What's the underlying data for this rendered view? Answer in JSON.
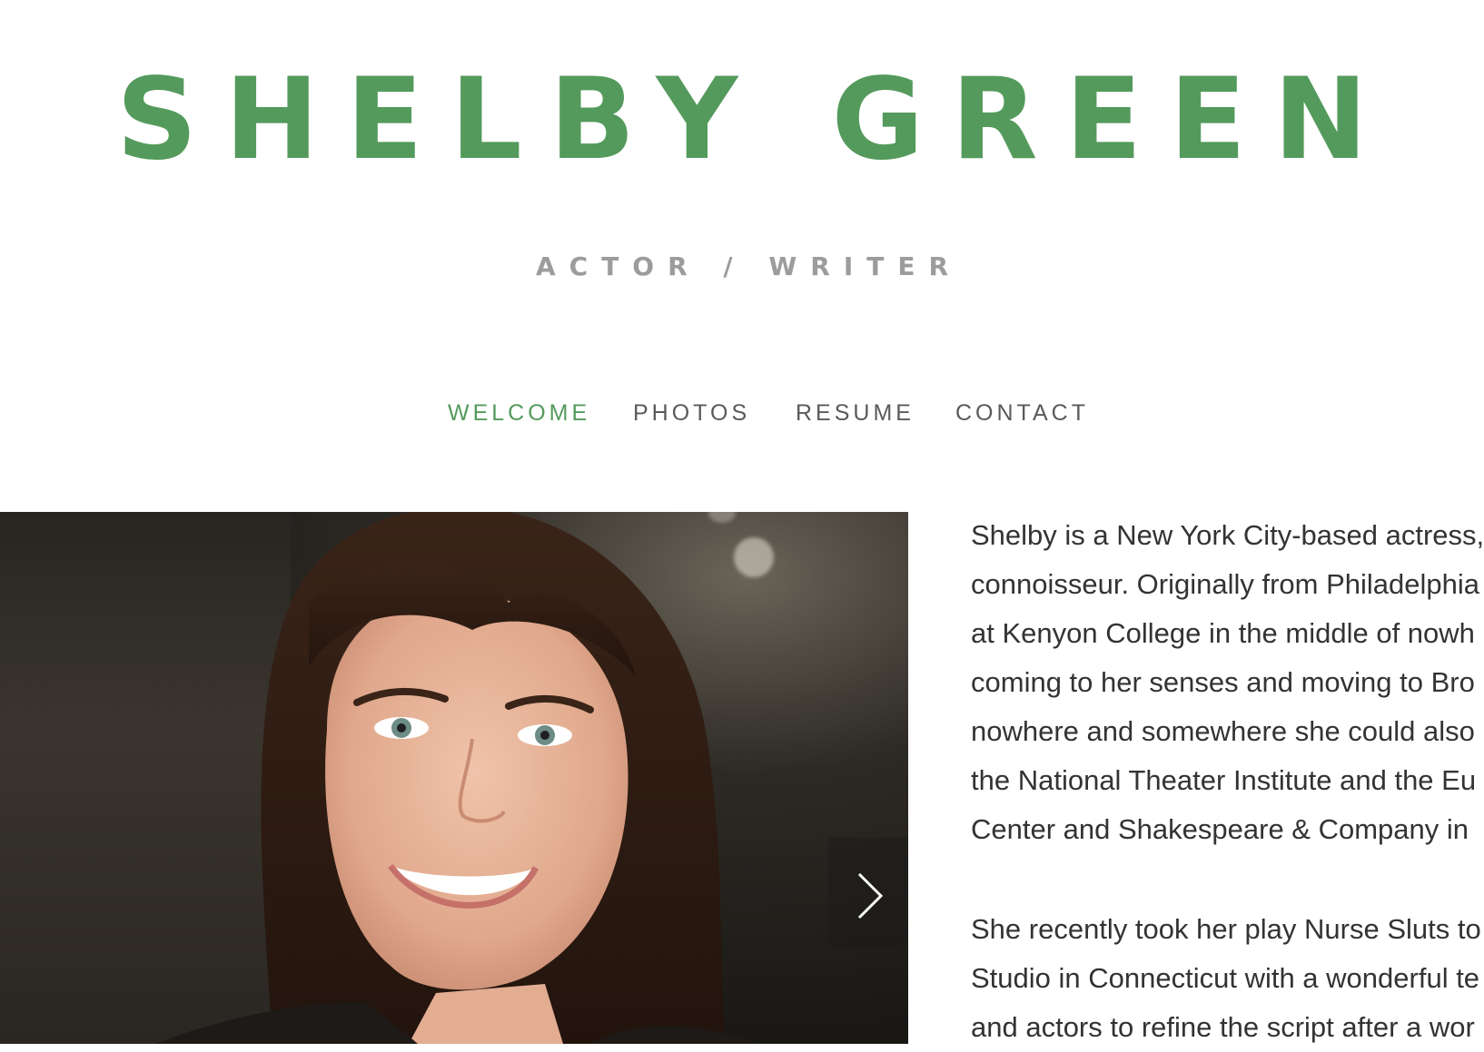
{
  "header": {
    "title": "SHELBY GREEN",
    "tagline": "ACTOR / WRITER"
  },
  "nav": {
    "items": [
      {
        "label": "WELCOME",
        "active": true
      },
      {
        "label": "PHOTOS",
        "active": false
      },
      {
        "label": "RESUME",
        "active": false
      },
      {
        "label": "CONTACT",
        "active": false
      }
    ]
  },
  "gallery": {
    "next_icon": "chevron-right-icon"
  },
  "bio": {
    "paragraphs": [
      [
        "Shelby is a New York City-based actress,",
        "connoisseur. Originally from Philadelphia",
        "at Kenyon College in the middle of nowh",
        "coming to her senses and moving to Bro",
        "nowhere and somewhere she could also",
        "the National Theater Institute and the Eu",
        "Center and  Shakespeare & Company in"
      ],
      [
        "She recently took her play Nurse Sluts to",
        "Studio in Connecticut with a wonderful te",
        "and actors to refine the script after a wor"
      ]
    ]
  },
  "colors": {
    "brand_green": "#549a5c",
    "tagline_gray": "#9c9c9c",
    "nav_gray": "#5a5a5a",
    "body_text": "#333333"
  }
}
